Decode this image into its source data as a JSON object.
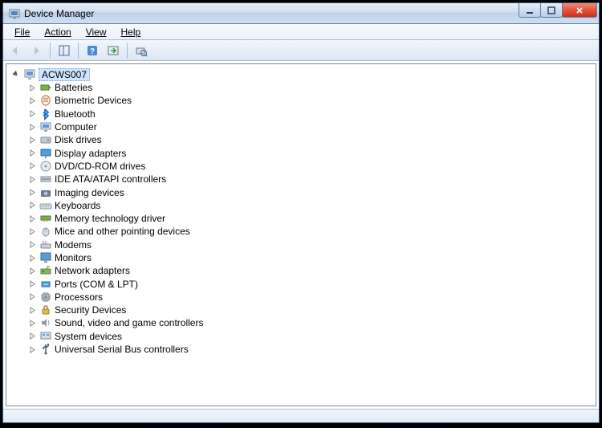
{
  "window": {
    "title": "Device Manager"
  },
  "menu": {
    "file": "File",
    "action": "Action",
    "view": "View",
    "help": "Help"
  },
  "root": {
    "name": "ACWS007"
  },
  "devices": [
    {
      "label": "Batteries",
      "icon": "battery"
    },
    {
      "label": "Biometric Devices",
      "icon": "biometric"
    },
    {
      "label": "Bluetooth",
      "icon": "bluetooth"
    },
    {
      "label": "Computer",
      "icon": "computer"
    },
    {
      "label": "Disk drives",
      "icon": "disk"
    },
    {
      "label": "Display adapters",
      "icon": "display"
    },
    {
      "label": "DVD/CD-ROM drives",
      "icon": "cdrom"
    },
    {
      "label": "IDE ATA/ATAPI controllers",
      "icon": "ide"
    },
    {
      "label": "Imaging devices",
      "icon": "camera"
    },
    {
      "label": "Keyboards",
      "icon": "keyboard"
    },
    {
      "label": "Memory technology driver",
      "icon": "memory"
    },
    {
      "label": "Mice and other pointing devices",
      "icon": "mouse"
    },
    {
      "label": "Modems",
      "icon": "modem"
    },
    {
      "label": "Monitors",
      "icon": "monitor"
    },
    {
      "label": "Network adapters",
      "icon": "network"
    },
    {
      "label": "Ports (COM & LPT)",
      "icon": "port"
    },
    {
      "label": "Processors",
      "icon": "cpu"
    },
    {
      "label": "Security Devices",
      "icon": "security"
    },
    {
      "label": "Sound, video and game controllers",
      "icon": "sound"
    },
    {
      "label": "System devices",
      "icon": "system"
    },
    {
      "label": "Universal Serial Bus controllers",
      "icon": "usb"
    }
  ]
}
